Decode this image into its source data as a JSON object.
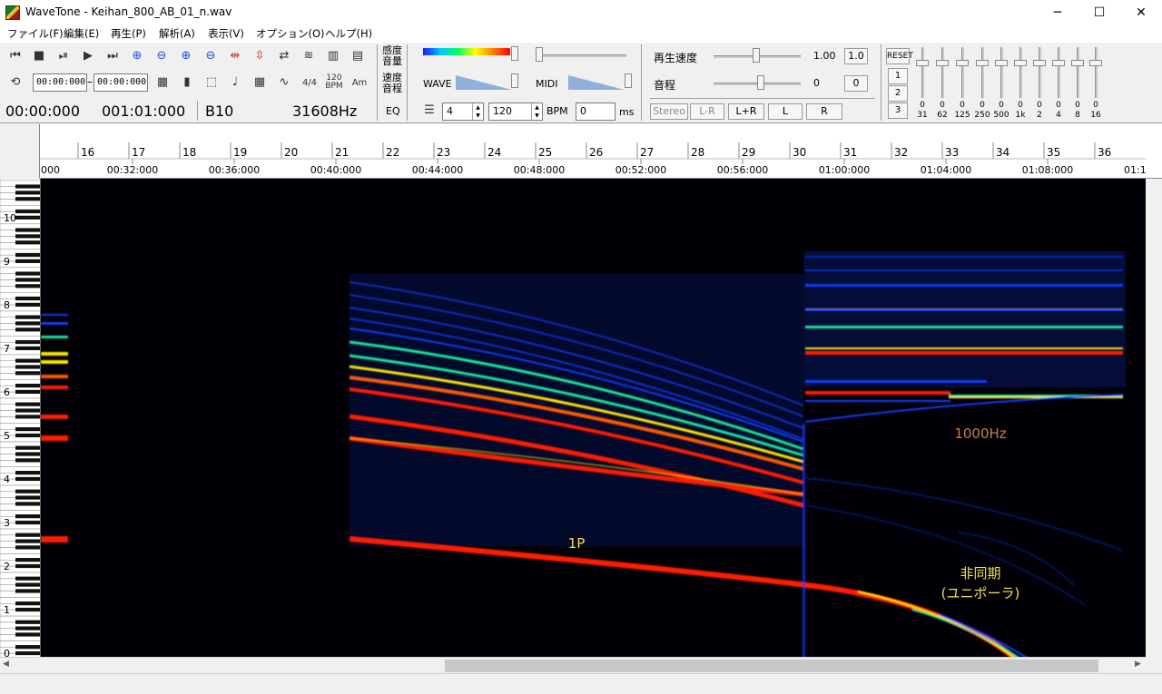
{
  "window": {
    "title": "WaveTone - Keihan_800_AB_01_n.wav",
    "minimize_glyph": "─",
    "maximize_glyph": "☐",
    "close_glyph": "✕"
  },
  "menu": [
    "ファイル(F)",
    "編集(E)",
    "再生(P)",
    "解析(A)",
    "表示(V)",
    "オプション(O)",
    "ヘルプ(H)"
  ],
  "transport": {
    "range_start": "00:00:000",
    "range_end": "00:00:000",
    "time_signature": "4/4",
    "bpm_top": "120",
    "bpm_bottom": "BPM",
    "chord_label": "Am"
  },
  "readout": {
    "position_time": "00:00:000",
    "position_measure": "001:01:000",
    "note": "B10",
    "frequency": "31608Hz"
  },
  "display_controls": {
    "sensitivity_top": "感度",
    "sensitivity_bottom": "音量",
    "speed_top": "速度",
    "speed_bottom": "音程",
    "eq_label": "EQ",
    "wave_label": "WAVE",
    "midi_label": "MIDI",
    "beats_value": "4",
    "bpm_value": "120",
    "bpm_unit": "BPM",
    "offset_value": "0",
    "offset_unit": "ms"
  },
  "playback": {
    "speed_label": "再生速度",
    "speed_value": "1.00",
    "speed_reset": "1.0",
    "pitch_label": "音程",
    "pitch_value": "0",
    "pitch_reset": "0",
    "channel_buttons": [
      "Stereo",
      "L-R",
      "L+R",
      "L",
      "R"
    ]
  },
  "equalizer": {
    "reset_label": "RESET",
    "presets": [
      "1",
      "2",
      "3"
    ],
    "bands": [
      {
        "value": "0",
        "freq": "31"
      },
      {
        "value": "0",
        "freq": "62"
      },
      {
        "value": "0",
        "freq": "125"
      },
      {
        "value": "0",
        "freq": "250"
      },
      {
        "value": "0",
        "freq": "500"
      },
      {
        "value": "0",
        "freq": "1k"
      },
      {
        "value": "0",
        "freq": "2"
      },
      {
        "value": "0",
        "freq": "4"
      },
      {
        "value": "0",
        "freq": "8"
      },
      {
        "value": "0",
        "freq": "16"
      }
    ]
  },
  "timeline": {
    "measures": [
      "16",
      "17",
      "18",
      "19",
      "20",
      "21",
      "22",
      "23",
      "24",
      "25",
      "26",
      "27",
      "28",
      "29",
      "30",
      "31",
      "32",
      "33",
      "34",
      "35",
      "36"
    ],
    "times_start_fragment": "000",
    "times": [
      "00:32:000",
      "00:36:000",
      "00:40:000",
      "00:44:000",
      "00:48:000",
      "00:52:000",
      "00:56:000",
      "01:00:000",
      "01:04:000",
      "01:08:000"
    ],
    "times_end_fragment": "01:1"
  },
  "keyboard": {
    "octaves": [
      "10",
      "9",
      "8",
      "7",
      "6",
      "5",
      "4",
      "3",
      "2",
      "1",
      "0"
    ]
  },
  "annotations": {
    "mode_1p": "1P",
    "freq_1000": "1000Hz",
    "async_line1": "非同期",
    "async_line2": "(ユニポーラ)"
  },
  "colors": {
    "spectrogram_background": "#000006",
    "harmonic_hot": "#ff1a00",
    "harmonic_warm": "#ffe600",
    "harmonic_mid": "#18e6a0",
    "harmonic_cold": "#0a3cff",
    "annotation_yellow": "#f2e24a",
    "annotation_orange": "#c8843c"
  }
}
